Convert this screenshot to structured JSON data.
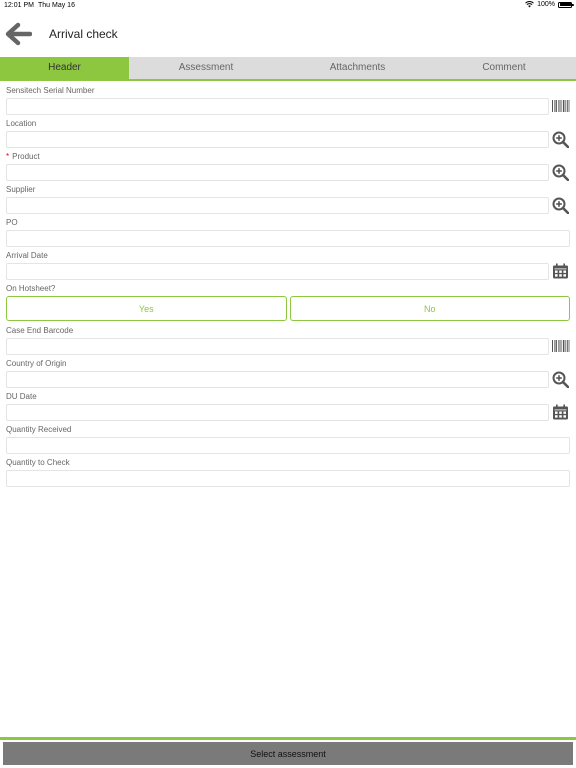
{
  "status_bar": {
    "time": "12:01 PM",
    "date": "Thu May 16",
    "battery": "100%"
  },
  "nav": {
    "title": "Arrival check",
    "back_icon": "arrow-left-icon"
  },
  "tabs": [
    {
      "label": "Header",
      "active": true
    },
    {
      "label": "Assessment",
      "active": false
    },
    {
      "label": "Attachments",
      "active": false
    },
    {
      "label": "Comment",
      "active": false
    }
  ],
  "fields": {
    "serial": {
      "label": "Sensitech Serial Number",
      "value": "",
      "icon": "barcode-icon"
    },
    "location": {
      "label": "Location",
      "value": "",
      "icon": "zoom-in-icon"
    },
    "product": {
      "label": "Product",
      "required_mark": "*",
      "value": "",
      "icon": "zoom-in-icon"
    },
    "supplier": {
      "label": "Supplier",
      "value": "",
      "icon": "zoom-in-icon"
    },
    "po": {
      "label": "PO",
      "value": ""
    },
    "arrival_date": {
      "label": "Arrival Date",
      "value": "",
      "icon": "calendar-icon"
    },
    "on_hotsheet": {
      "label": "On Hotsheet?",
      "options": [
        "Yes",
        "No"
      ]
    },
    "case_end_barcode": {
      "label": "Case End Barcode",
      "value": "",
      "icon": "barcode-icon"
    },
    "country_of_origin": {
      "label": "Country of Origin",
      "value": "",
      "icon": "zoom-in-icon"
    },
    "du_date": {
      "label": "DU Date",
      "value": "",
      "icon": "calendar-icon"
    },
    "quantity_received": {
      "label": "Quantity Received",
      "value": ""
    },
    "quantity_to_check": {
      "label": "Quantity to Check",
      "value": ""
    }
  },
  "footer": {
    "button_label": "Select assessment"
  },
  "colors": {
    "accent": "#8dc63f",
    "tab_bar": "#dcdcdc",
    "footer_button": "#7a7a7a",
    "required": "#e2001a"
  }
}
